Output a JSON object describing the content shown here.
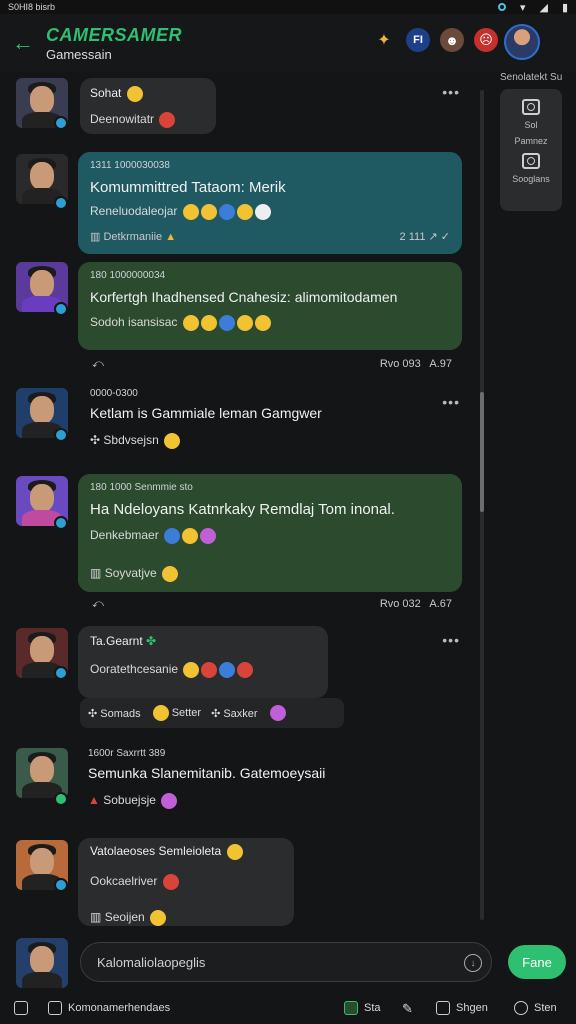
{
  "status_bar": {
    "left_text": "S0HI8 bisrb",
    "icons": [
      "cast-icon",
      "wifi-icon",
      "signal-icon",
      "battery-icon"
    ]
  },
  "app_bar": {
    "brand": "CAMERSAMER",
    "subtitle": "Gamessain",
    "icons": [
      "trophy-icon",
      "fi-badge-icon",
      "face-icon",
      "angry-icon"
    ]
  },
  "side_panel": {
    "title": "Senolatekt Su",
    "item1_label": "Sol",
    "item1_sub": "Pamnez",
    "item2_label": "Sooglans"
  },
  "messages": [
    {
      "title": "Sohat",
      "body": "Deenowitatr",
      "color": "dark"
    },
    {
      "meta": "1311 1000030038",
      "title": "Komummittred Tataom: Merik",
      "sub": "Reneluodaleojar",
      "footer_left": "Detkrmaniie",
      "footer_right": "2 111"
    },
    {
      "meta": "180 1000000034",
      "title": "Korfertgh Ihadhensed Cnahesiz: alimomitodamen",
      "sub": "Sodoh isansisac",
      "footer_right": "Rvo 093",
      "footer_right2": "A.97"
    },
    {
      "meta": "0000-0300",
      "title": "Ketlam is Gammiale leman Gamgwer",
      "sub": "Sbdvsejsn"
    },
    {
      "meta": "180 1000 Senmmie sto",
      "title": "Ha Ndeloyans Katnrkaky Remdlaj Tom inonal.",
      "sub": "Denkebmaer",
      "footer_left": "Soyvatjve",
      "footer_right": "Rvo 032",
      "footer_right2": "A.67"
    },
    {
      "title": "Ta.Gearnt",
      "body": "Ooratethcesanie",
      "reactions": [
        "Somads",
        "Setter",
        "Saxker"
      ]
    },
    {
      "meta": "1600r Saxrrtt 389",
      "title": "Semunka Slanemitanib. Gatemoeysaii",
      "sub": "Sobuejsje"
    },
    {
      "title": "Vatolaeoses Semleioleta",
      "body": "Ookcaelriver",
      "footer_left": "Seoijen"
    }
  ],
  "composer": {
    "placeholder": "Kalomaliolaopeglis",
    "send_label": "Fane"
  },
  "bottom_bar": {
    "left_label": "Komonamerhendaes",
    "items": [
      "Sta",
      "Shgen",
      "Sten"
    ]
  }
}
